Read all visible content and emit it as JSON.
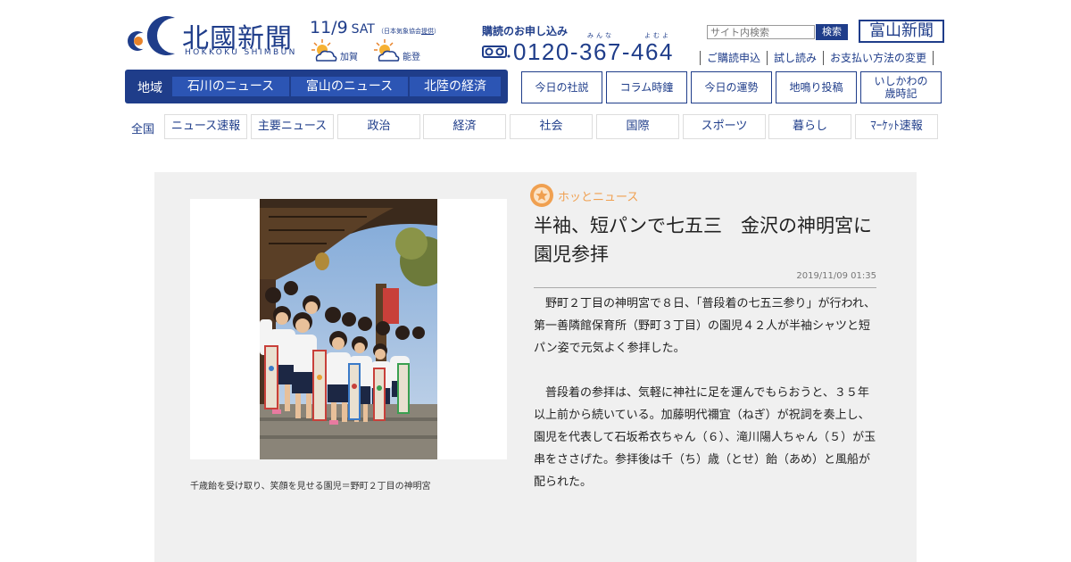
{
  "header": {
    "logo_name": "北國新聞",
    "logo_sub": "HOKKOKU SHIMBUN",
    "date": "11/9",
    "weekday": "SAT",
    "weather_provider_prefix": "（日本気象協会",
    "weather_provider_link": "提供",
    "weather_provider_suffix": "）",
    "weather": [
      {
        "area": "加賀",
        "icon": "sun-cloud-icon"
      },
      {
        "area": "能登",
        "icon": "sun-cloud-icon"
      }
    ],
    "subscribe_title": "購読のお申し込み",
    "ruby_minna": "みんな",
    "ruby_yomu": "よむよ",
    "phone": "0120-367-464",
    "search_placeholder": "サイト内検索",
    "search_button": "検索",
    "toyama_logo": "富山新聞",
    "sub_links": [
      "ご購読申込",
      "試し読み",
      "お支払い方法の変更"
    ]
  },
  "region_nav": {
    "label": "地域",
    "tabs": [
      "石川のニュース",
      "富山のニュース",
      "北陸の経済"
    ]
  },
  "feature_buttons": [
    "今日の社説",
    "コラム時鐘",
    "今日の運勢",
    "地鳴り投稿",
    "いしかわの歳時記"
  ],
  "national_nav": {
    "label": "全国",
    "tabs": [
      "ニュース速報",
      "主要ニュース",
      "政治",
      "経済",
      "社会",
      "国際",
      "スポーツ",
      "暮らし",
      "ﾏｰｹｯﾄ速報"
    ]
  },
  "article": {
    "category": "ホッとニュース",
    "headline": "半袖、短パンで七五三　金沢の神明宮に園児参拝",
    "timestamp": "2019/11/09 01:35",
    "caption": "千歳飴を受け取り、笑顔を見せる園児＝野町２丁目の神明宮",
    "paragraphs": [
      "野町２丁目の神明宮で８日、「普段着の七五三参り」が行われ、第一善隣館保育所（野町３丁目）の園児４２人が半袖シャツと短パン姿で元気よく参拝した。",
      "普段着の参拝は、気軽に神社に足を運んでもらおうと、３５年以上前から続いている。加藤明代禰宜（ねぎ）が祝詞を奏上し、園児を代表して石坂希衣ちゃん（６）、滝川陽人ちゃん（５）が玉串をささげた。参拝後は千（ち）歳（とせ）飴（あめ）と風船が配られた。"
    ]
  },
  "colors": {
    "brand": "#1f3d8a",
    "tab_active": "#2c55b4",
    "category": "#f0a050",
    "article_bg": "#f0f0f0"
  }
}
